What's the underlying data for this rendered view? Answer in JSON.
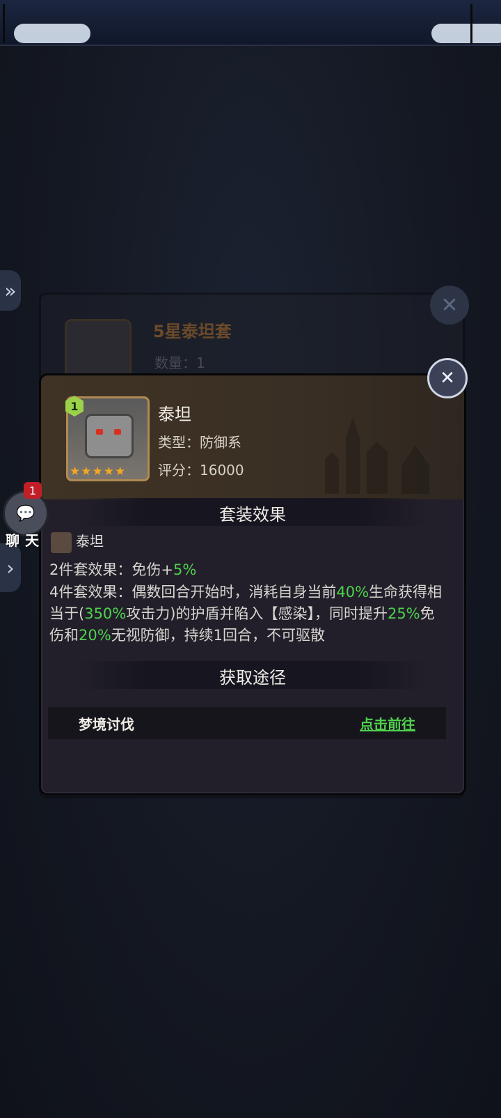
{
  "back_panel": {
    "title": "5星泰坦套",
    "quantity": "数量：1"
  },
  "hero": {
    "level": "1",
    "name": "泰坦",
    "type_label": "类型：防御系",
    "score_label": "评分：16000",
    "stars": 5
  },
  "set_section": {
    "title": "套装效果",
    "set_name": "泰坦",
    "effect2_prefix": "2件套效果：免伤+",
    "effect2_value": "5%",
    "effect4_a": "4件套效果：偶数回合开始时，消耗自身当前",
    "effect4_v1": "40%",
    "effect4_b": "生命获得相当于(",
    "effect4_v2": "350%",
    "effect4_c": "攻击力)的护盾并陷入【感染】，同时提升",
    "effect4_v3": "25%",
    "effect4_d": "免伤和",
    "effect4_v4": "20%",
    "effect4_e": "无视防御，持续1回合，不可驱散"
  },
  "source_section": {
    "title": "获取途径",
    "source_name": "梦境讨伐",
    "goto_label": "点击前往"
  },
  "chat": {
    "badge": "1",
    "label": "聊天"
  },
  "colors": {
    "highlight_green": "#4fd24d",
    "star": "#f5a623"
  }
}
